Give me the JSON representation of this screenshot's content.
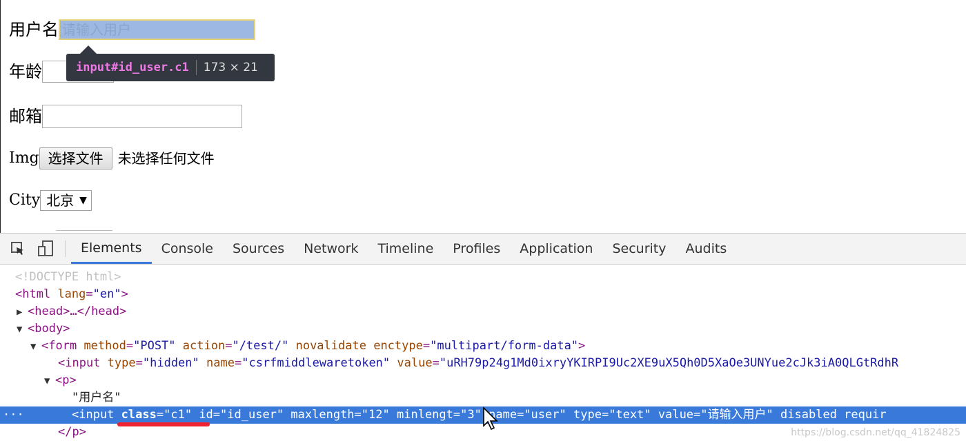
{
  "form": {
    "user_label": "用户名",
    "user_placeholder": "请输入用户",
    "age_label": "年龄",
    "email_label": "邮箱",
    "img_label": "Img",
    "file_button": "选择文件",
    "file_status": "未选择任何文件",
    "city_label": "City",
    "city_selected": "北京"
  },
  "tooltip": {
    "selector": "input#id_user.c1",
    "size": "173 × 21"
  },
  "devtools": {
    "tabs": [
      "Elements",
      "Console",
      "Sources",
      "Network",
      "Timeline",
      "Profiles",
      "Application",
      "Security",
      "Audits"
    ],
    "active_tab": "Elements",
    "code": {
      "doctype": "<!DOCTYPE html>",
      "html_open": "<html",
      "html_attr": "lang",
      "html_val": "\"en\"",
      "head": "<head>…</head>",
      "body": "<body>",
      "form_open": "<form",
      "form_attrs": [
        {
          "name": "method",
          "value": "\"POST\""
        },
        {
          "name": "action",
          "value": "\"/test/\""
        },
        {
          "name": "novalidate",
          "value": ""
        },
        {
          "name": "enctype",
          "value": "\"multipart/form-data\""
        }
      ],
      "hidden_input": {
        "tag": "<input",
        "type_val": "\"hidden\"",
        "name_val": "\"csrfmiddlewaretoken\"",
        "value_val": "\"uRH79p24g1Md0ixryYKIRPI9Uc2XE9uX5Qh0D5XaOe3UNYue2cJk3iA0QLGtRdhR"
      },
      "p_open": "<p>",
      "text_node": "\"用户名\"",
      "selected_input": {
        "tag": "<input",
        "class_val": "\"c1\"",
        "id_val": "\"id_user\"",
        "maxlength_val": "\"12\"",
        "minlength_name": "minlengt",
        "minlength_val": "\"3\"",
        "name_val": "\"user\"",
        "type_val": "\"text\"",
        "value_val": "请输入用户",
        "tail": "disabled requir"
      },
      "p_close": "</p>"
    }
  },
  "watermark": "https://blog.csdn.net/qq_41824825"
}
